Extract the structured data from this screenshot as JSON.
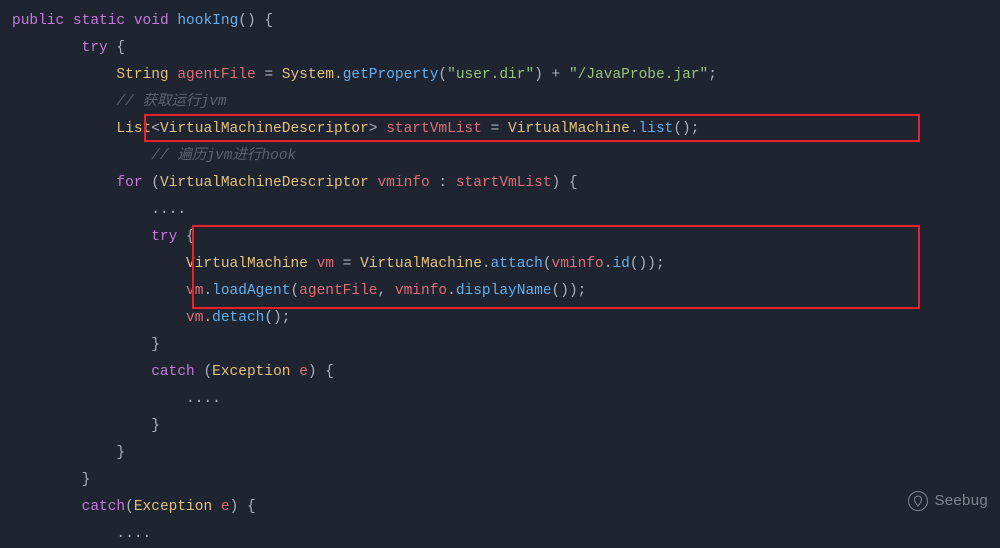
{
  "code": {
    "l1": {
      "kw1": "public",
      "kw2": "static",
      "kw3": "void",
      "method": "hookIng",
      "paren": "() {"
    },
    "l2": {
      "kw": "try",
      "brace": " {"
    },
    "l3": {
      "type": "String",
      "var": "agentFile",
      "eq": " = ",
      "cls": "System",
      "dot": ".",
      "m": "getProperty",
      "call": "(",
      "str": "\"user.dir\"",
      "close": ") + ",
      "str2": "\"/JavaProbe.jar\"",
      "end": ";"
    },
    "l4": {
      "comment": "// 获取运行jvm"
    },
    "l5": {
      "type": "List",
      "lt": "<",
      "gtype": "VirtualMachineDescriptor",
      "gt": ">",
      "var": "startVmList",
      "eq": " = ",
      "cls": "VirtualMachine",
      "dot": ".",
      "m": "list",
      "end": "();"
    },
    "l6": {
      "comment": "// 遍历jvm进行hook"
    },
    "l7": {
      "kw": "for",
      "open": " (",
      "type": "VirtualMachineDescriptor",
      "var": "vminfo",
      "colon": " : ",
      "var2": "startVmList",
      "close": ") {"
    },
    "l8": {
      "dots": "...."
    },
    "l9": {
      "kw": "try",
      "brace": " {"
    },
    "l10": {
      "type": "VirtualMachine",
      "var": "vm",
      "eq": " = ",
      "cls": "VirtualMachine",
      "dot": ".",
      "m": "attach",
      "open": "(",
      "var2": "vminfo",
      "dot2": ".",
      "m2": "id",
      "close": "());"
    },
    "l11": {
      "var": "vm",
      "dot": ".",
      "m": "loadAgent",
      "open": "(",
      "var2": "agentFile",
      "comma": ", ",
      "var3": "vminfo",
      "dot2": ".",
      "m2": "displayName",
      "close": "());"
    },
    "l12": {
      "var": "vm",
      "dot": ".",
      "m": "detach",
      "end": "();"
    },
    "l13": {
      "brace": "}"
    },
    "l14": {
      "kw": "catch",
      "open": " (",
      "type": "Exception",
      "var": "e",
      "close": ") {"
    },
    "l15": {
      "dots": "...."
    },
    "l16": {
      "brace": "}"
    },
    "l17": {
      "brace": "}"
    },
    "l18": {
      "brace": "}"
    },
    "l19": {
      "kw": "catch",
      "open": "(",
      "type": "Exception",
      "var": "e",
      "close": ") {"
    },
    "l20": {
      "dots": "...."
    }
  },
  "watermark": {
    "text": "Seebug"
  }
}
